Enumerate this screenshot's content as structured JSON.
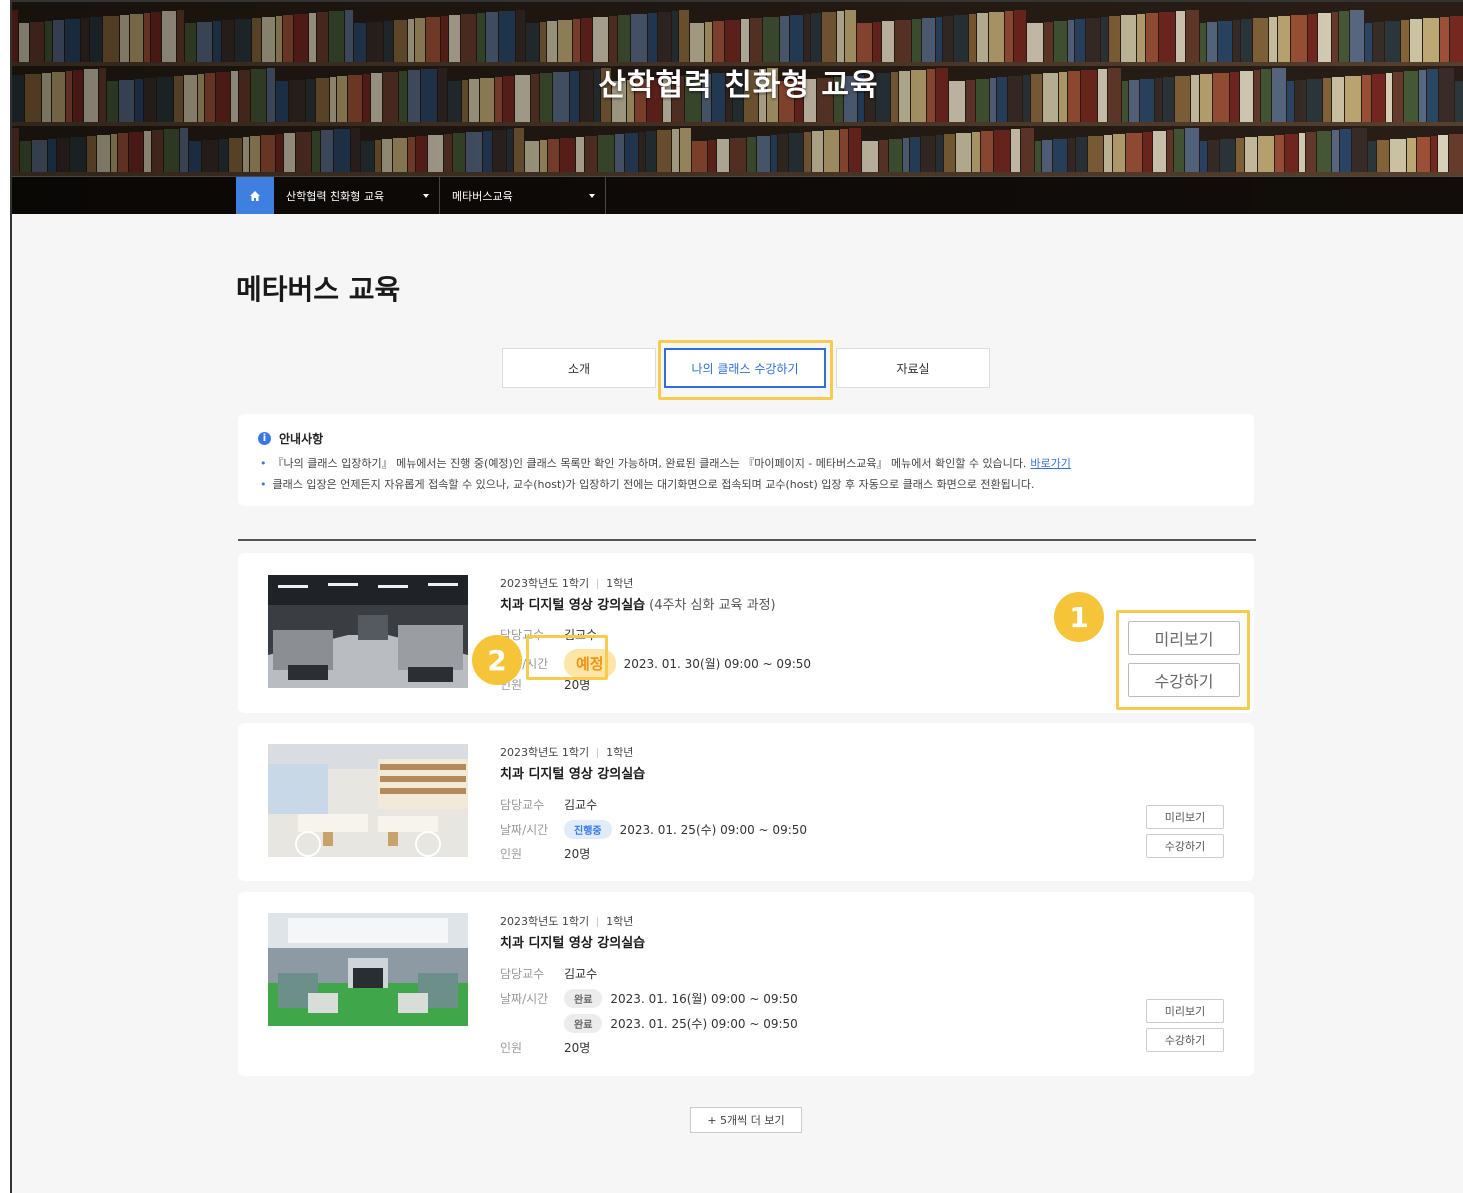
{
  "hero": {
    "title": "산학협력 친화형 교육"
  },
  "nav": {
    "home_icon": "home-icon",
    "dropdown1": "산학협력 친화형 교육",
    "dropdown2": "메타버스교육"
  },
  "page": {
    "title": "메타버스 교육"
  },
  "tabs": [
    {
      "label": "소개"
    },
    {
      "label": "나의 클래스 수강하기",
      "active": true
    },
    {
      "label": "자료실"
    }
  ],
  "notice": {
    "heading": "안내사항",
    "lines": [
      "『나의 클래스 입장하기』 메뉴에서는 진행 중(예정)인 클래스 목록만 확인 가능하며, 완료된 클래스는 『마이페이지 - 메타버스교육』 메뉴에서 확인할 수 있습니다.",
      "클래스 입장은 언제든지 자유롭게 접속할 수 있으나, 교수(host)가 입장하기 전에는 대기화면으로 접속되며 교수(host) 입장 후 자동으로 클래스 화면으로 전환됩니다."
    ],
    "link": "바로가기"
  },
  "labels": {
    "professor": "담당교수",
    "datetime": "날짜/시간",
    "people": "인원",
    "preview": "미리보기",
    "enroll": "수강하기"
  },
  "cards": [
    {
      "semester": "2023학년도 1학기",
      "grade": "1학년",
      "title": "치과 디지털 영상 강의실습",
      "subtitle": "(4주차 심화 교육 과정)",
      "professor": "김교수",
      "status": "예정",
      "date": "2023. 01. 30(월) 09:00 ~ 09:50",
      "people": "20명",
      "callout_buttons": "1",
      "callout_status": "2"
    },
    {
      "semester": "2023학년도 1학기",
      "grade": "1학년",
      "title": "치과 디지털 영상 강의실습",
      "professor": "김교수",
      "status": "진행중",
      "date": "2023. 01. 25(수) 09:00 ~ 09:50",
      "people": "20명"
    },
    {
      "semester": "2023학년도 1학기",
      "grade": "1학년",
      "title": "치과 디지털 영상 강의실습",
      "professor": "김교수",
      "sessions": [
        {
          "status": "완료",
          "date": "2023. 01. 16(월) 09:00 ~ 09:50"
        },
        {
          "status": "완료",
          "date": "2023. 01. 25(수) 09:00 ~ 09:50"
        }
      ],
      "people": "20명"
    }
  ],
  "more": {
    "label": "+ 5개씩 더 보기"
  },
  "colors": {
    "accent": "#2f6fdb",
    "highlight": "#f5cc4e",
    "callout": "#f5c438"
  }
}
